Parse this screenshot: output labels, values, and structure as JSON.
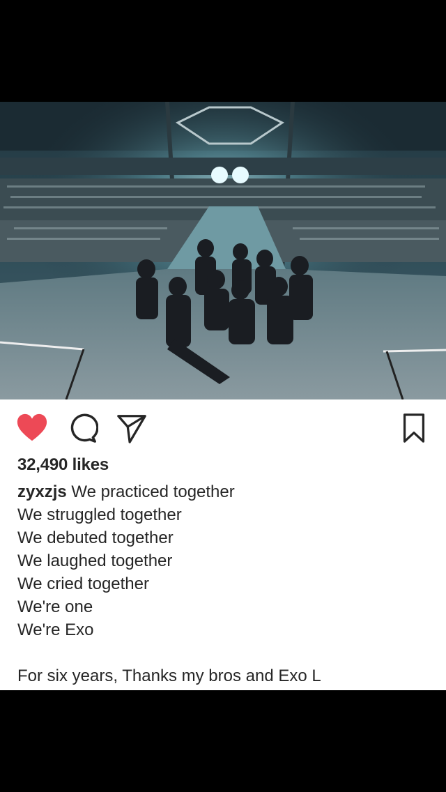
{
  "post": {
    "likes_text": "32,490 likes",
    "username": "zyxzjs",
    "caption_first_line": "We practiced together",
    "caption_lines": [
      "We struggled together",
      "We debuted together",
      "We laughed together",
      "We cried together",
      "We're one",
      "We're Exo"
    ],
    "caption_last_line": "For six years, Thanks my bros and Exo L"
  },
  "icons": {
    "like": "heart-icon",
    "comment": "comment-icon",
    "share": "paper-plane-icon",
    "save": "bookmark-icon"
  },
  "colors": {
    "like_red": "#ed4956",
    "text": "#262626"
  }
}
